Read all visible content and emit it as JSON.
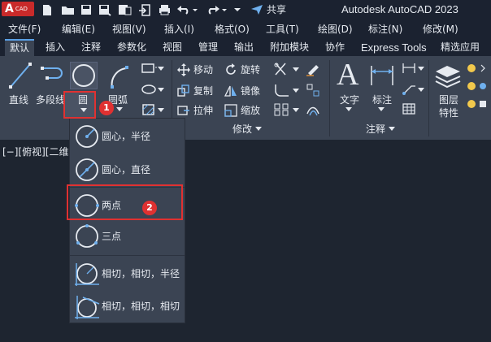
{
  "titlebar": {
    "logo_main": "A",
    "logo_sub": "CAD",
    "share_label": "共享",
    "app_title": "Autodesk AutoCAD 2023"
  },
  "menubar": {
    "items": [
      "文件(F)",
      "编辑(E)",
      "视图(V)",
      "插入(I)",
      "格式(O)",
      "工具(T)",
      "绘图(D)",
      "标注(N)",
      "修改(M)"
    ]
  },
  "tabs": {
    "items": [
      "默认",
      "插入",
      "注释",
      "参数化",
      "视图",
      "管理",
      "输出",
      "附加模块",
      "协作",
      "Express Tools",
      "精选应用"
    ],
    "active_index": 0
  },
  "ribbon": {
    "draw": {
      "line": "直线",
      "polyline": "多段线",
      "circle": "圆",
      "arc": "圆弧"
    },
    "modify": {
      "title": "修改",
      "move": "移动",
      "rotate": "旋转",
      "copy": "复制",
      "mirror": "镜像",
      "stretch": "拉伸",
      "scale": "缩放"
    },
    "annotation": {
      "title": "注释",
      "text": "文字",
      "dimension": "标注"
    },
    "layers": {
      "label_line1": "图层",
      "label_line2": "特性"
    }
  },
  "viewport": {
    "label": "[−][俯视][二维"
  },
  "circle_menu": {
    "items": [
      "圆心，半径",
      "圆心，直径",
      "两点",
      "三点",
      "相切，相切，半径",
      "相切，相切，相切"
    ]
  },
  "callouts": {
    "step1": "1",
    "step2": "2"
  },
  "colors": {
    "accent": "#5aa0e6",
    "highlight": "#e03131",
    "ribbon_bg": "#3b4453",
    "app_bg": "#1e2530"
  }
}
